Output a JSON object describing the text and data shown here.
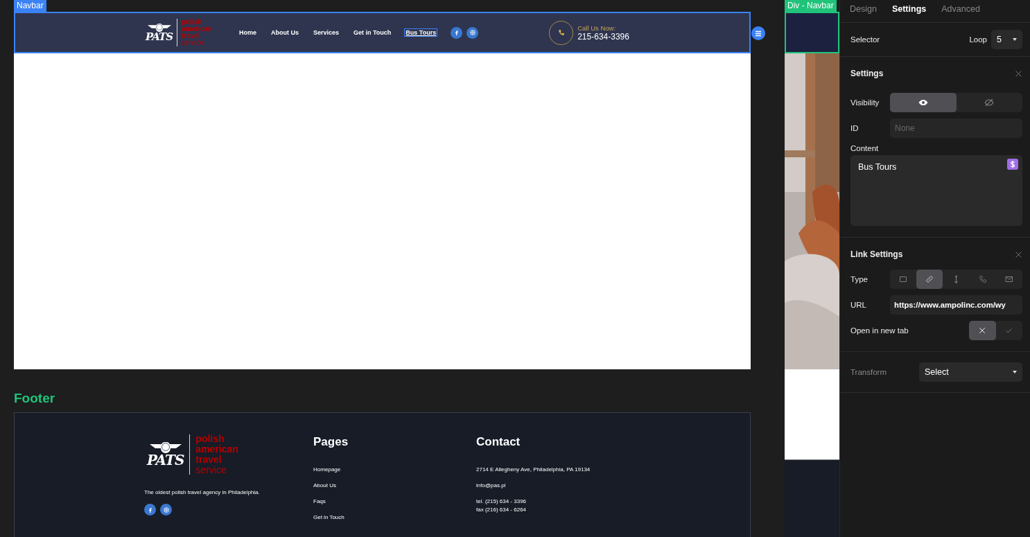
{
  "canvas": {
    "navbar_label": "Navbar",
    "footer_label": "Footer"
  },
  "navbar": {
    "logo": {
      "mark": "PATS",
      "lines": [
        "polish",
        "american",
        "travel",
        "service"
      ]
    },
    "links": [
      {
        "label": "Home",
        "selected": false
      },
      {
        "label": "About Us",
        "selected": false
      },
      {
        "label": "Services",
        "selected": false
      },
      {
        "label": "Get in Touch",
        "selected": false
      },
      {
        "label": "Bus Tours",
        "selected": true
      }
    ],
    "social": [
      {
        "kind": "facebook"
      },
      {
        "kind": "instagram"
      }
    ],
    "call": {
      "label": "Call Us Now:",
      "phone": "215-634-3396"
    }
  },
  "footer": {
    "logo": {
      "mark": "PATS",
      "lines": [
        "polish",
        "american",
        "travel",
        "service"
      ]
    },
    "tagline": "The oldest polish travel agency in Philadelphia.",
    "social": [
      {
        "kind": "facebook"
      },
      {
        "kind": "instagram"
      }
    ],
    "pages": {
      "title": "Pages",
      "links": [
        "Homepage",
        "About Us",
        "Faqs",
        "Get in Touch"
      ]
    },
    "contact": {
      "title": "Contact",
      "address": "2714 E Allegheny Ave, Philadelphia, PA 19134",
      "email": "info@pas.pl",
      "phone": "tel. (215) 634 - 3396",
      "fax": "fax (216) 634 - 6264"
    }
  },
  "preview": {
    "label": "Div - Navbar"
  },
  "panel": {
    "tabs": [
      {
        "label": "Design",
        "selected": false
      },
      {
        "label": "Settings",
        "selected": true
      },
      {
        "label": "Advanced",
        "selected": false
      }
    ],
    "selector": {
      "label": "Selector",
      "loop_label": "Loop",
      "loop_value": "5"
    },
    "settings": {
      "title": "Settings",
      "visibility": {
        "label": "Visibility",
        "options": [
          {
            "kind": "visible",
            "selected": true
          },
          {
            "kind": "hidden",
            "selected": false
          }
        ]
      },
      "id": {
        "label": "ID",
        "placeholder": "None"
      },
      "content": {
        "label": "Content",
        "value": "Bus Tours"
      }
    },
    "link_settings": {
      "title": "Link Settings",
      "type": {
        "label": "Type",
        "options": [
          {
            "kind": "page",
            "selected": false
          },
          {
            "kind": "url",
            "selected": true
          },
          {
            "kind": "anchor",
            "selected": false
          },
          {
            "kind": "phone",
            "selected": false
          },
          {
            "kind": "email",
            "selected": false
          }
        ]
      },
      "url": {
        "label": "URL",
        "value": "https://www.ampolinc.com/wy"
      },
      "new_tab": {
        "label": "Open in new tab",
        "on": false
      }
    },
    "transform": {
      "label": "Transform",
      "value": "Select"
    }
  }
}
